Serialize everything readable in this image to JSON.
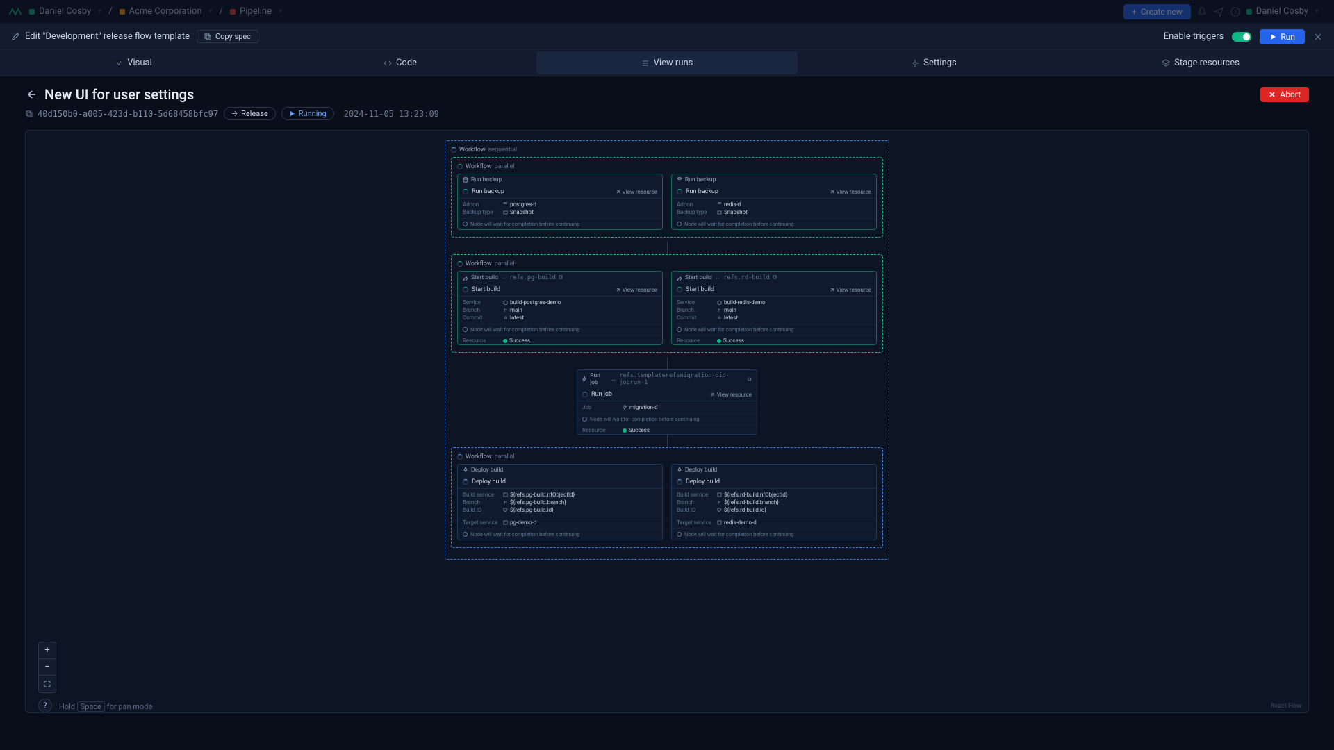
{
  "topbar": {
    "breadcrumbs": [
      {
        "label": "Daniel Cosby",
        "color": "#10b981"
      },
      {
        "label": "Acme Corporation",
        "color": "#f59e0b"
      },
      {
        "label": "Pipeline",
        "color": "#ef4444"
      }
    ],
    "createNew": "Create new",
    "user": "Daniel Cosby"
  },
  "subheader": {
    "editLabel": "Edit \"Development\" release flow template",
    "copySpec": "Copy spec",
    "enableTriggers": "Enable triggers",
    "run": "Run"
  },
  "tabs": {
    "visual": "Visual",
    "code": "Code",
    "viewRuns": "View runs",
    "settings": "Settings",
    "stageResources": "Stage resources"
  },
  "run": {
    "title": "New UI for user settings",
    "id": "40d150b0-a005-423d-b110-5d68458bfc97",
    "releaseBadge": "Release",
    "runningBadge": "Running",
    "timestamp": "2024-11-05 13:23:09",
    "abort": "Abort"
  },
  "workflow": {
    "sequentialLabel": "Workflow",
    "sequentialType": "sequential",
    "parallelLabel": "Workflow",
    "parallelType": "parallel",
    "waitNote": "Node will wait for completion before continuing",
    "viewResource": "View resource",
    "success": "Success"
  },
  "block1": {
    "stub": "Run backup",
    "head": "Run backup",
    "left": {
      "addon": {
        "k": "Addon",
        "v": "postgres-d"
      },
      "backupType": {
        "k": "Backup type",
        "v": "Snapshot"
      }
    },
    "right": {
      "addon": {
        "k": "Addon",
        "v": "redis-d"
      },
      "backupType": {
        "k": "Backup type",
        "v": "Snapshot"
      }
    }
  },
  "block2": {
    "stub": "Start build",
    "head": "Start build",
    "leftRef": "refs.pg-build",
    "rightRef": "refs.rd-build",
    "left": {
      "service": {
        "k": "Service",
        "v": "build-postgres-demo"
      },
      "branch": {
        "k": "Branch",
        "v": "main"
      },
      "commit": {
        "k": "Commit",
        "v": "latest"
      },
      "resource": {
        "k": "Resource",
        "v": "Success"
      }
    },
    "right": {
      "service": {
        "k": "Service",
        "v": "build-redis-demo"
      },
      "branch": {
        "k": "Branch",
        "v": "main"
      },
      "commit": {
        "k": "Commit",
        "v": "latest"
      },
      "resource": {
        "k": "Resource",
        "v": "Success"
      }
    }
  },
  "block3": {
    "stub": "Run job",
    "ref": "refs.templaterefsmigration-did-jobrun-1",
    "head": "Run job",
    "job": {
      "k": "Job",
      "v": "migration-d"
    },
    "resource": {
      "k": "Resource",
      "v": "Success"
    }
  },
  "block4": {
    "stub": "Deploy build",
    "head": "Deploy build",
    "left": {
      "buildService": {
        "k": "Build service",
        "v": "${refs.pg-build.nfObjectId}"
      },
      "branch": {
        "k": "Branch",
        "v": "${refs.pg-build.branch}"
      },
      "buildId": {
        "k": "Build ID",
        "v": "${refs.pg-build.id}"
      },
      "targetService": {
        "k": "Target service",
        "v": "pg-demo-d"
      }
    },
    "right": {
      "buildService": {
        "k": "Build service",
        "v": "${refs.rd-build.nfObjectId}"
      },
      "branch": {
        "k": "Branch",
        "v": "${refs.rd-build.branch}"
      },
      "buildId": {
        "k": "Build ID",
        "v": "${refs.rd-build.id}"
      },
      "targetService": {
        "k": "Target service",
        "v": "redis-demo-d"
      }
    }
  },
  "canvas": {
    "hintHold": "Hold",
    "hintKey": "Space",
    "hintFor": "for pan mode",
    "reactFlow": "React Flow"
  }
}
